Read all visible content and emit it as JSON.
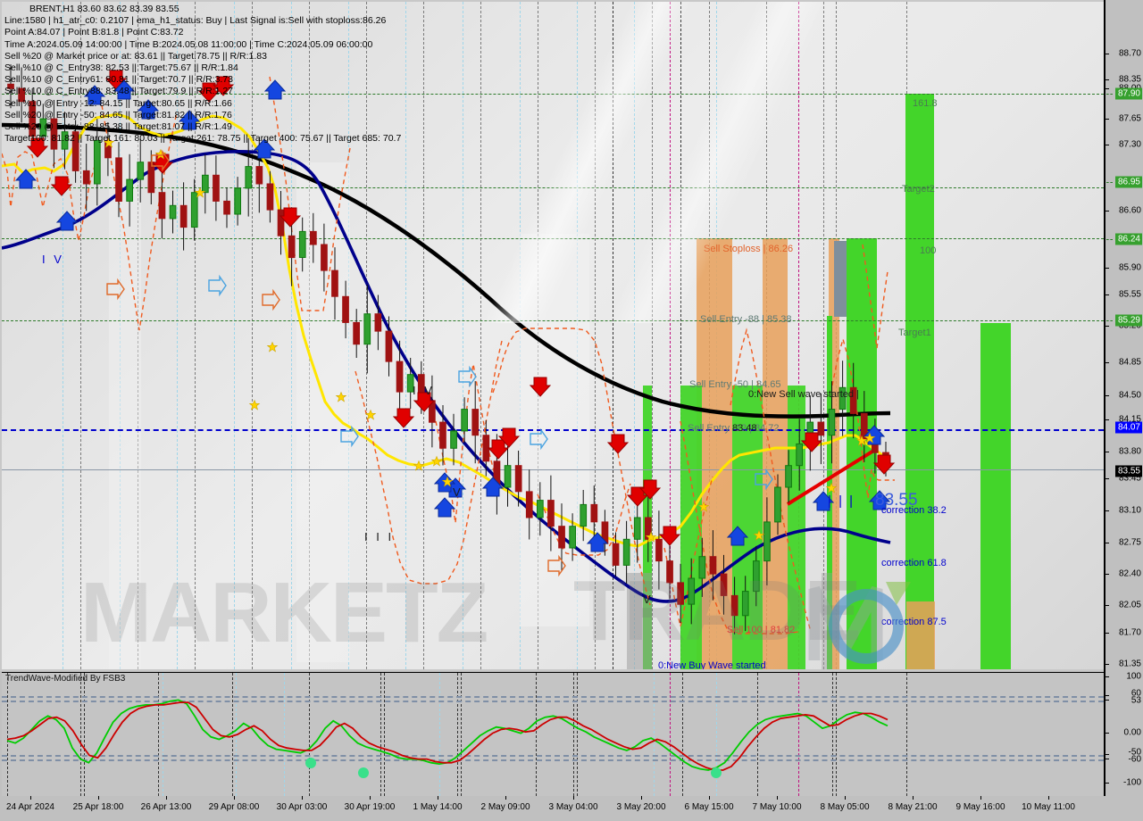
{
  "header": {
    "symbol_line": "BRENT,H1  83.60 83.62 83.39 83.55",
    "lines": [
      "Line:1580 | h1_atr_c0: 0.2107 | ema_h1_status: Buy | Last Signal is:Sell with stoploss:86.26",
      "Point A:84.07 | Point B:81.8 | Point C:83.72",
      "Time A:2024.05.09 14:00:00 | Time B:2024.05.08 11:00:00 | Time C:2024.05.09 06:00:00",
      "Sell %20 @ Market price or at: 83.61 || Target:78.75 || R/R:1.83",
      "Sell %10 @ C_Entry38: 82.53 || Target:75.67 || R/R:1.84",
      "Sell %10 @ C_Entry61: 80.81 || Target:70.7 || R/R:3.73",
      "Sell %10 @ C_Entry88: 83.48 || Target:79.9 || R/R:1.27",
      "Sell %10 @ Entry -12: 84.15 || Target:80.65 || R/R:1.66",
      "Sell %20 @ Entry -50: 84.65 || Target:81.82 || R/R:1.76",
      "Sell %20 @ Entry -88: 85.38 || Target:81.07 || R/R:1.49",
      "Target100: 81.82 || Target 161: 80.03 || Target 261: 78.75 || Target 400: 75.67 || Target 685: 70.7"
    ]
  },
  "indicator": {
    "title": "TrendWave-Modified By FSB3",
    "axis_labels": [
      "100",
      "60",
      "53",
      "0.00",
      "-50",
      "-60",
      "-100"
    ]
  },
  "price_axis": {
    "ticks": [
      "88.70",
      "88.35",
      "88.00",
      "87.65",
      "87.30",
      "86.60",
      "85.90",
      "85.55",
      "85.20",
      "84.85",
      "84.50",
      "84.15",
      "83.80",
      "83.45",
      "83.10",
      "82.75",
      "82.40",
      "82.05",
      "81.70",
      "81.35"
    ],
    "badges": [
      {
        "value": "87.90",
        "color": "green"
      },
      {
        "value": "86.95",
        "color": "green"
      },
      {
        "value": "86.24",
        "color": "green"
      },
      {
        "value": "85.29",
        "color": "green"
      },
      {
        "value": "84.07",
        "color": "blue"
      },
      {
        "value": "83.55",
        "color": "black"
      }
    ]
  },
  "annotations": {
    "sell_stoploss": "Sell Stoploss | 86.26",
    "sell_entry_88": "Sell Entry -88 | 85.38",
    "sell_entry_50": "Sell Entry -50 | 84.65",
    "sell_entry_12": "Sell Entry -12 | 84.72",
    "c_entry_88": "83.48",
    "new_sell_wave": "0:New Sell wave started |",
    "new_buy_wave": "0:New Buy Wave started",
    "sell_100": "Sell 100 | 81.82",
    "price_big": "83.55",
    "price_big_prefix": "| | |",
    "fib_1618": "161.8",
    "fib_target2": "Target2",
    "fib_100": "100",
    "fib_target1": "Target1",
    "correction_382": "correction 38.2",
    "correction_618": "correction 61.8",
    "correction_875": "correction 87.5",
    "wave_iv": "I V",
    "wave_iii": "I I I"
  },
  "watermark": {
    "text1": "MARKETZ",
    "text2": "TRADE"
  },
  "time_axis": {
    "labels": [
      "24 Apr 2024",
      "25 Apr 18:00",
      "26 Apr 13:00",
      "29 Apr 08:00",
      "30 Apr 03:00",
      "30 Apr 19:00",
      "1 May 14:00",
      "2 May 09:00",
      "3 May 04:00",
      "3 May 20:00",
      "6 May 15:00",
      "7 May 10:00",
      "8 May 05:00",
      "8 May 21:00",
      "9 May 16:00",
      "10 May 11:00"
    ]
  },
  "chart_data": {
    "type": "line",
    "title": "BRENT,H1  83.60 83.62 83.39 83.55",
    "xlabel": "",
    "ylabel": "",
    "ylim": [
      81.2,
      88.9
    ],
    "grid": true,
    "legend": "none",
    "x_tick_labels": [
      "24 Apr 2024",
      "25 Apr 18:00",
      "26 Apr 13:00",
      "29 Apr 08:00",
      "30 Apr 03:00",
      "30 Apr 19:00",
      "1 May 14:00",
      "2 May 09:00",
      "3 May 04:00",
      "3 May 20:00",
      "6 May 15:00",
      "7 May 10:00",
      "8 May 05:00",
      "8 May 21:00",
      "9 May 16:00",
      "10 May 11:00"
    ],
    "y_tick_labels": [
      "88.70",
      "88.35",
      "88.00",
      "87.65",
      "87.30",
      "86.60",
      "85.90",
      "85.55",
      "85.20",
      "84.85",
      "84.50",
      "84.15",
      "83.80",
      "83.45",
      "83.10",
      "82.75",
      "82.40",
      "82.05",
      "81.70",
      "81.35"
    ],
    "series": [
      {
        "name": "Close (OHLC candles)",
        "color": "#1a7a1a/#a01212",
        "values": [
          87.9,
          87.75,
          87.35,
          87.55,
          87.2,
          87.4,
          86.95,
          86.8,
          87.3,
          87.1,
          86.6,
          86.85,
          87.05,
          86.7,
          86.4,
          86.55,
          86.3,
          86.7,
          86.9,
          86.6,
          86.45,
          86.75,
          87.0,
          86.8,
          86.5,
          86.2,
          85.95,
          86.25,
          86.1,
          85.8,
          85.5,
          85.2,
          84.95,
          85.3,
          85.1,
          84.75,
          84.4,
          84.6,
          84.3,
          84.05,
          83.75,
          83.95,
          84.2,
          83.9,
          83.6,
          83.3,
          83.55,
          83.25,
          82.95,
          83.15,
          82.85,
          82.6,
          82.85,
          83.1,
          82.9,
          82.65,
          82.4,
          82.7,
          82.95,
          82.7,
          82.45,
          82.2,
          81.95,
          82.25,
          82.5,
          82.3,
          82.05,
          81.82,
          82.1,
          82.45,
          82.9,
          83.3,
          83.55,
          83.8,
          84.05,
          83.9,
          84.2,
          84.45,
          84.15,
          83.85,
          83.7,
          83.55
        ]
      },
      {
        "name": "EMA fast (yellow)",
        "color": "#ffe600",
        "values": [
          87.8,
          87.6,
          87.45,
          87.3,
          87.15,
          87.0,
          86.9,
          86.95,
          86.85,
          86.7,
          86.6,
          86.65,
          86.7,
          86.6,
          86.5,
          86.45,
          86.4,
          86.45,
          86.55,
          86.5,
          86.4,
          86.45,
          86.55,
          86.5,
          86.35,
          86.15,
          85.95,
          85.95,
          85.85,
          85.65,
          85.4,
          85.15,
          84.95,
          84.95,
          84.85,
          84.65,
          84.45,
          84.4,
          84.25,
          84.05,
          83.9,
          83.9,
          83.95,
          83.85,
          83.7,
          83.5,
          83.45,
          83.35,
          83.2,
          83.15,
          83.05,
          82.9,
          82.9,
          82.95,
          82.9,
          82.8,
          82.65,
          82.65,
          82.7,
          82.65,
          82.5,
          82.35,
          82.2,
          82.25,
          82.35,
          82.3,
          82.15,
          82.05,
          82.1,
          82.3,
          82.6,
          82.9,
          83.15,
          83.4,
          83.65,
          83.7,
          83.85,
          84.05,
          84.0,
          83.85,
          83.75,
          83.65
        ]
      },
      {
        "name": "EMA slow (navy)",
        "color": "#00008b",
        "values": [
          86.1,
          86.2,
          86.35,
          86.5,
          86.65,
          86.8,
          86.9,
          87.0,
          87.05,
          87.05,
          87.0,
          86.95,
          86.9,
          86.85,
          86.8,
          86.75,
          86.7,
          86.7,
          86.7,
          86.65,
          86.6,
          86.55,
          86.5,
          86.4,
          86.25,
          86.05,
          85.85,
          85.65,
          85.45,
          85.25,
          85.05,
          84.85,
          84.65,
          84.5,
          84.35,
          84.2,
          84.05,
          83.95,
          83.85,
          83.7,
          83.55,
          83.45,
          83.35,
          83.25,
          83.15,
          83.05,
          82.95,
          82.85,
          82.75,
          82.65,
          82.55,
          82.45,
          82.4,
          82.35,
          82.3,
          82.25,
          82.2,
          82.15,
          82.1,
          82.05,
          82.0,
          81.98,
          81.97,
          81.96,
          81.96,
          81.97,
          82.0,
          82.05,
          82.12,
          82.22,
          82.35,
          82.5,
          82.65,
          82.8,
          82.95,
          83.1,
          83.25,
          83.4,
          83.5,
          83.58,
          83.63,
          83.66
        ]
      },
      {
        "name": "Long MA (black)",
        "color": "#000000",
        "values": [
          88.55,
          88.52,
          88.48,
          88.44,
          88.4,
          88.36,
          88.32,
          88.28,
          88.24,
          88.2,
          88.15,
          88.1,
          88.05,
          88.0,
          87.92,
          87.84,
          87.76,
          87.66,
          87.56,
          87.44,
          87.32,
          87.2,
          87.08,
          86.96,
          86.84,
          86.72,
          86.6,
          86.48,
          86.36,
          86.24,
          86.12,
          86.0,
          85.9,
          85.8,
          85.7,
          85.6,
          85.5,
          85.42,
          85.34,
          85.26,
          85.18,
          85.1,
          85.02,
          84.96,
          84.9,
          84.84,
          84.78,
          84.72,
          84.66,
          84.62,
          84.58,
          84.54,
          84.5,
          84.47,
          84.44,
          84.41,
          84.38,
          84.36,
          84.34,
          84.32,
          84.3,
          84.29,
          84.28,
          84.27,
          84.26,
          84.25,
          84.25,
          84.25,
          84.25,
          84.25,
          84.25,
          84.26,
          84.27,
          84.28,
          84.29,
          84.3,
          84.31,
          84.32,
          84.32,
          84.31,
          84.3,
          84.28
        ]
      }
    ],
    "levels": [
      {
        "label": "Sell Stoploss | 86.26",
        "value": 86.26,
        "color": "#e2622a"
      },
      {
        "label": "Sell Entry -88 | 85.38",
        "value": 85.38,
        "color": "#5f7a74"
      },
      {
        "label": "Sell Entry -50 | 84.65",
        "value": 84.65,
        "color": "#5f7a74"
      },
      {
        "label": "Sell Entry -12 | 84.72",
        "value": 84.72,
        "color": "#5f7a74"
      },
      {
        "label": "Sell 100 | 81.82",
        "value": 81.82,
        "color": "#e23c3c"
      },
      {
        "label": "161.8",
        "value": 87.9,
        "color": "#4a7c52"
      },
      {
        "label": "Target2",
        "value": 86.95,
        "color": "#4a7c52"
      },
      {
        "label": "100",
        "value": 86.24,
        "color": "#4a7c52"
      },
      {
        "label": "Target1",
        "value": 85.29,
        "color": "#4a7c52"
      },
      {
        "label": "correction 38.2",
        "value": 83.12,
        "color": "#0000cd"
      },
      {
        "label": "correction 61.8",
        "value": 82.52,
        "color": "#0000cd"
      },
      {
        "label": "correction 87.5",
        "value": 81.95,
        "color": "#0000cd"
      }
    ],
    "subplot": {
      "type": "line",
      "title": "TrendWave-Modified By FSB3",
      "ylim": [
        -100,
        100
      ],
      "y_tick_labels": [
        "100",
        "60",
        "53",
        "0.00",
        "-50",
        "-60",
        "-100"
      ],
      "hlines": [
        60,
        53,
        -50,
        -60
      ],
      "series": [
        {
          "name": "TrendWave fast",
          "color": "#00cc00",
          "values": [
            -10,
            -14,
            -6,
            8,
            22,
            30,
            24,
            10,
            -22,
            -40,
            -46,
            -30,
            -4,
            20,
            34,
            42,
            46,
            48,
            48,
            50,
            54,
            56,
            50,
            30,
            8,
            -4,
            -8,
            -2,
            6,
            18,
            10,
            -6,
            -18,
            -24,
            -26,
            -28,
            -30,
            -24,
            -10,
            10,
            22,
            14,
            -2,
            -14,
            -20,
            -24,
            -28,
            -32,
            -38,
            -40,
            -40,
            -42,
            -46,
            -48,
            -46,
            -38,
            -26,
            -14,
            -2,
            6,
            12,
            10,
            6,
            2,
            10,
            22,
            28,
            30,
            26,
            18,
            10,
            4,
            -4,
            -10,
            -16,
            -22,
            -26,
            -20,
            -10,
            -6,
            -14,
            -24,
            -34,
            -44,
            -52,
            -56,
            -58,
            -54,
            -46,
            -30,
            -12,
            4,
            16,
            24,
            28,
            30,
            32,
            34,
            30,
            20,
            10,
            14,
            24,
            32,
            36,
            34,
            28,
            20,
            14
          ]
        },
        {
          "name": "TrendWave slow",
          "color": "#cc0000",
          "values": [
            -8,
            -6,
            -2,
            6,
            16,
            26,
            28,
            22,
            6,
            -16,
            -34,
            -38,
            -22,
            0,
            20,
            34,
            42,
            46,
            48,
            48,
            50,
            52,
            52,
            44,
            26,
            8,
            -2,
            -4,
            0,
            8,
            14,
            6,
            -8,
            -18,
            -22,
            -24,
            -26,
            -26,
            -18,
            -4,
            12,
            18,
            10,
            -4,
            -14,
            -20,
            -24,
            -28,
            -34,
            -38,
            -40,
            -40,
            -44,
            -46,
            -46,
            -42,
            -32,
            -20,
            -8,
            2,
            8,
            10,
            8,
            4,
            6,
            16,
            24,
            28,
            28,
            22,
            14,
            8,
            0,
            -8,
            -14,
            -20,
            -24,
            -22,
            -14,
            -8,
            -12,
            -20,
            -30,
            -40,
            -48,
            -54,
            -58,
            -58,
            -52,
            -38,
            -20,
            -4,
            10,
            20,
            26,
            28,
            30,
            32,
            30,
            22,
            14,
            16,
            24,
            30,
            34,
            34,
            30,
            24
          ]
        }
      ],
      "markers": [
        {
          "x": 0.345,
          "y": -46
        },
        {
          "x": 0.405,
          "y": -62
        },
        {
          "x": 0.805,
          "y": -62
        }
      ]
    }
  }
}
